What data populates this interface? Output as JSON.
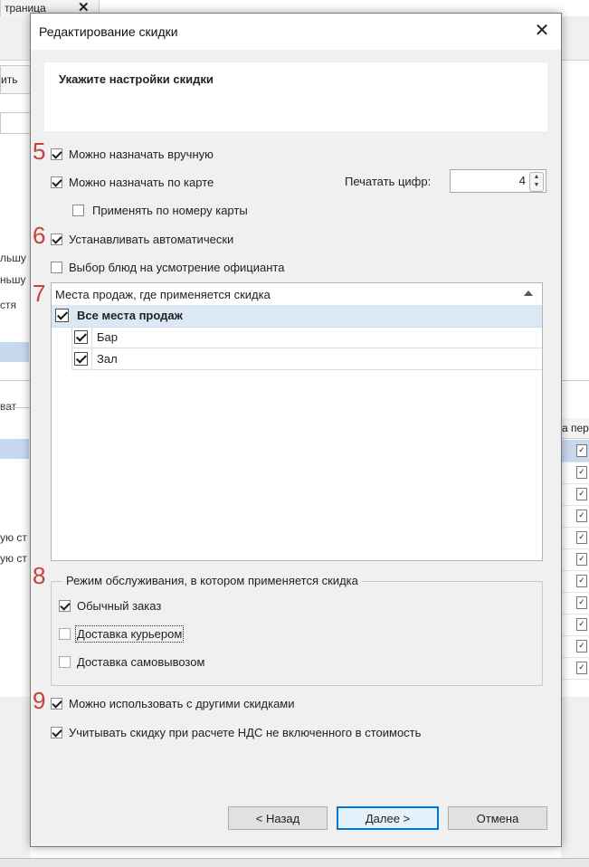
{
  "background": {
    "tab_label": "траница",
    "tab_close": "✕",
    "button_label": "ить",
    "texts": [
      "льшу",
      "ньшу",
      "стя",
      "ват",
      "ую ст",
      "ую ст"
    ],
    "right_header": "а пер"
  },
  "dialog": {
    "title": "Редактирование скидки",
    "close_glyph": "✕",
    "header": "Укажите настройки скидки",
    "step_markers": [
      "5",
      "6",
      "7",
      "8",
      "9"
    ],
    "options": {
      "manual": {
        "label": "Можно назначать вручную",
        "checked": true
      },
      "by_card": {
        "label": "Можно назначать по карте",
        "checked": true
      },
      "by_card_number": {
        "label": "Применять по номеру карты",
        "checked": false
      },
      "auto": {
        "label": "Устанавливать автоматически",
        "checked": true
      },
      "waiter_choice": {
        "label": "Выбор блюд на усмотрение официанта",
        "checked": false
      }
    },
    "print_digits": {
      "label": "Печатать цифр:",
      "value": "4"
    },
    "places": {
      "title": "Места продаж, где применяется скидка",
      "all": {
        "label": "Все места продаж",
        "checked": true
      },
      "items": [
        {
          "label": "Бар",
          "checked": true
        },
        {
          "label": "Зал",
          "checked": true
        }
      ]
    },
    "service_modes": {
      "title": "Режим обслуживания, в котором применяется скидка",
      "items": [
        {
          "label": "Обычный заказ",
          "checked": true
        },
        {
          "label": "Доставка курьером",
          "checked": false
        },
        {
          "label": "Доставка самовывозом",
          "checked": false
        }
      ]
    },
    "combine": {
      "label": "Можно использовать с другими скидками",
      "checked": true
    },
    "vat": {
      "label": "Учитывать скидку при расчете НДС не включенного в стоимость",
      "checked": true
    },
    "buttons": {
      "back": "< Назад",
      "next": "Далее >",
      "cancel": "Отмена"
    }
  }
}
